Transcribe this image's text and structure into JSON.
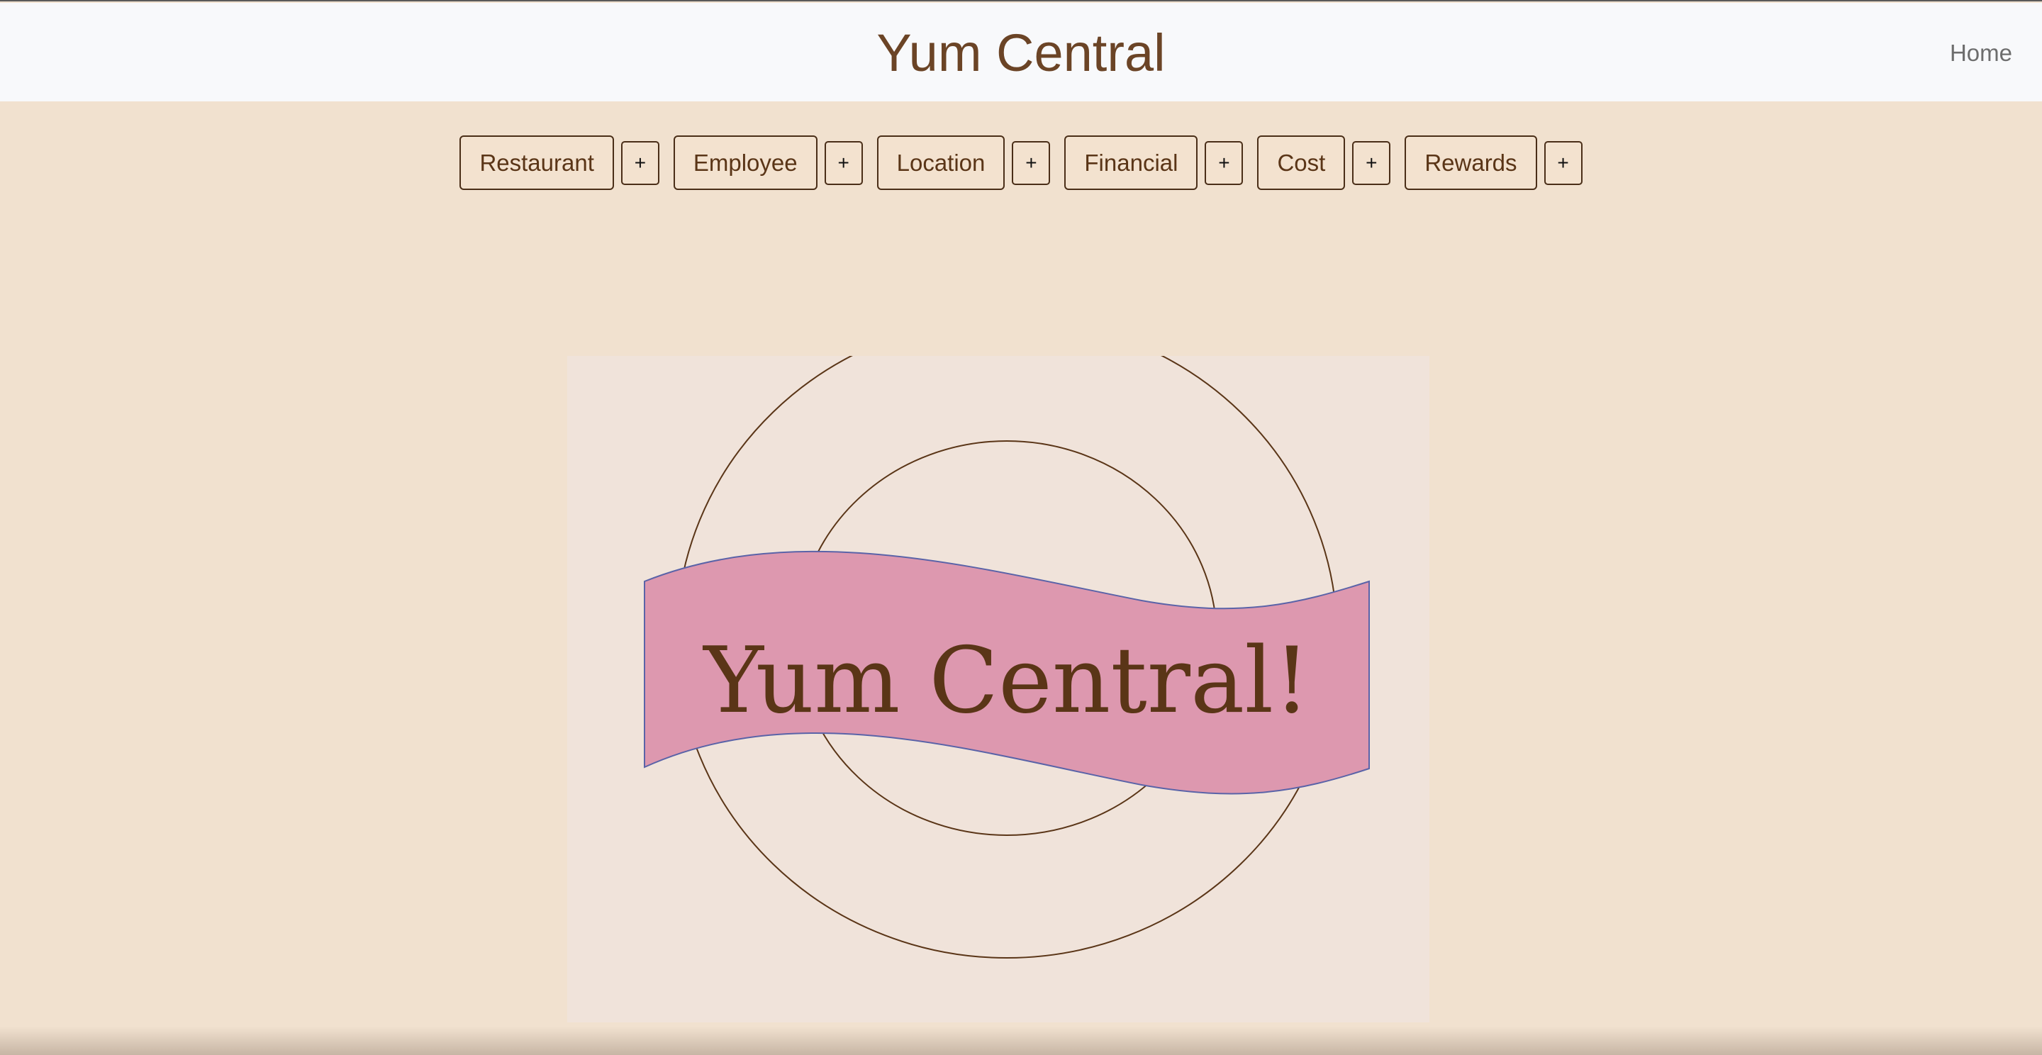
{
  "navbar": {
    "brand": "Yum Central",
    "home_link": "Home"
  },
  "toolbar": {
    "buttons": [
      {
        "label": "Restaurant",
        "add_label": "+"
      },
      {
        "label": "Employee",
        "add_label": "+"
      },
      {
        "label": "Location",
        "add_label": "+"
      },
      {
        "label": "Financial",
        "add_label": "+"
      },
      {
        "label": "Cost",
        "add_label": "+"
      },
      {
        "label": "Rewards",
        "add_label": "+"
      }
    ]
  },
  "hero": {
    "logo_text": "Yum Central!"
  },
  "colors": {
    "page_background": "#f1e1cf",
    "navbar_background": "#f8f9fb",
    "brand_text": "#6b4426",
    "button_border": "#4a2e18",
    "logo_panel": "#f0e3da",
    "banner_fill": "#dd98af",
    "banner_stroke": "#5a63a8",
    "ring_stroke": "#5a3517"
  }
}
